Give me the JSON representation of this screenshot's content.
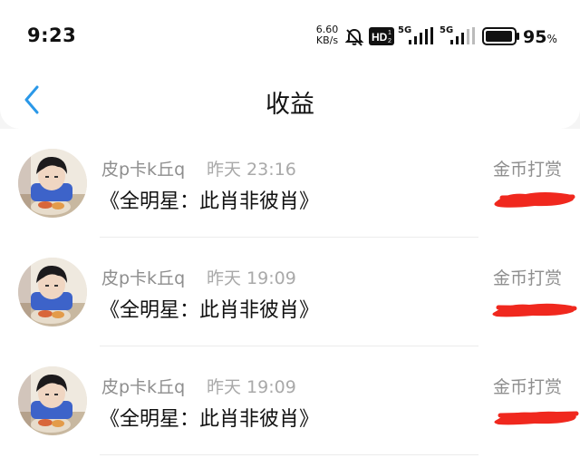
{
  "status_bar": {
    "time": "9:23",
    "net_speed_value": "6.60",
    "net_speed_unit": "KB/s",
    "signal1": "5G",
    "signal2": "5G",
    "battery_value": "95",
    "battery_unit": "%",
    "battery_level": 0.95
  },
  "header": {
    "title": "收益"
  },
  "records": [
    {
      "name": "皮p卡k丘q",
      "time": "昨天 23:16",
      "work": "《全明星：此肖非彼肖》",
      "type": "金币打赏"
    },
    {
      "name": "皮p卡k丘q",
      "time": "昨天 19:09",
      "work": "《全明星：此肖非彼肖》",
      "type": "金币打赏"
    },
    {
      "name": "皮p卡k丘q",
      "time": "昨天 19:09",
      "work": "《全明星：此肖非彼肖》",
      "type": "金币打赏"
    }
  ],
  "colors": {
    "accent": "#2a98e8",
    "redaction": "#f0281e"
  }
}
